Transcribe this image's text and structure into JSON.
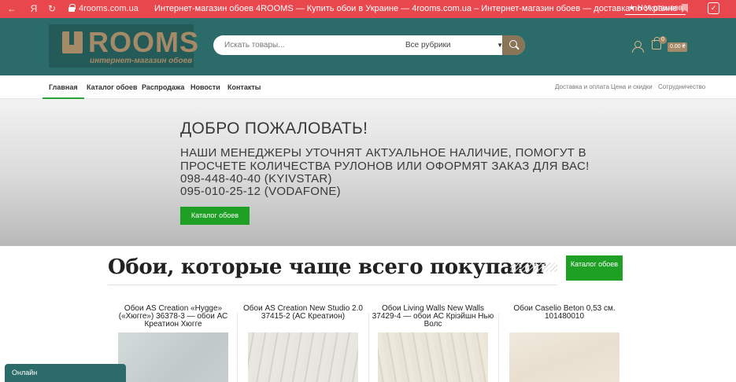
{
  "browser": {
    "url": "4rooms.com.ua",
    "title": "Интернет-магазин обоев 4ROOMS — Купить обои в Украине — 4rooms.com.ua – Интернет-магазин обоев — доставка по Украине",
    "reviews_label": "★ Нет отзывов",
    "nav_icons": [
      "back-icon",
      "forward-icon",
      "yandex-icon",
      "reload-icon"
    ],
    "brand_label": "Я"
  },
  "header": {
    "logo_text": "ROOMS",
    "logo_subtitle": "интернет-магазин обоев",
    "search_placeholder": "Искать товары...",
    "category_selected": "Все рубрики",
    "cart_count": "0",
    "cart_total": "0.00 ₴"
  },
  "nav": {
    "items": [
      {
        "label": "Главная",
        "active": true
      },
      {
        "label": "Каталог обоев"
      },
      {
        "label": "Распродажа"
      },
      {
        "label": "Новости"
      },
      {
        "label": "Контакты"
      }
    ],
    "right_items": [
      {
        "label": "Доставка и оплата"
      },
      {
        "label": "Цена и скидки"
      },
      {
        "label": "Сотрудничество"
      }
    ]
  },
  "hero": {
    "title": "ДОБРО ПОЖАЛОВАТЬ!",
    "lines": [
      "НАШИ МЕНЕДЖЕРЫ УТОЧНЯТ АКТУАЛЬНОЕ НАЛИЧИЕ, ПОМОГУТ В",
      "ПРОСЧЕТЕ КОЛИЧЕСТВА РУЛОНОВ ИЛИ ОФОРМЯТ ЗАКАЗ ДЛЯ ВАС!",
      "098-448-40-40 (KYIVSTAR)",
      "095-010-25-12 (VODAFONE)"
    ],
    "button_label": "Каталог обоев"
  },
  "popular": {
    "title": "Обои, которые чаще всего покупают",
    "button_label": "Каталог обоев",
    "products": [
      {
        "name": "Обои AS Creation «Hygge» («Хюгге») 36378-3 — обои АС Креатион Хюгге",
        "color": "#c9d3d2"
      },
      {
        "name": "Обои AS Creation New Studio 2.0 37415-2 (АС Креатион)",
        "color": "#e3e1db"
      },
      {
        "name": "Обои Living Walls New Walls 37429-4 — обои АС Крiэйшн Нью Волс",
        "color": "#e6e0d2"
      },
      {
        "name": "Обои Caselio Beton 0,53 см. 101480010",
        "color": "#efe7da"
      }
    ]
  },
  "chat": {
    "label": "Онлайн"
  }
}
